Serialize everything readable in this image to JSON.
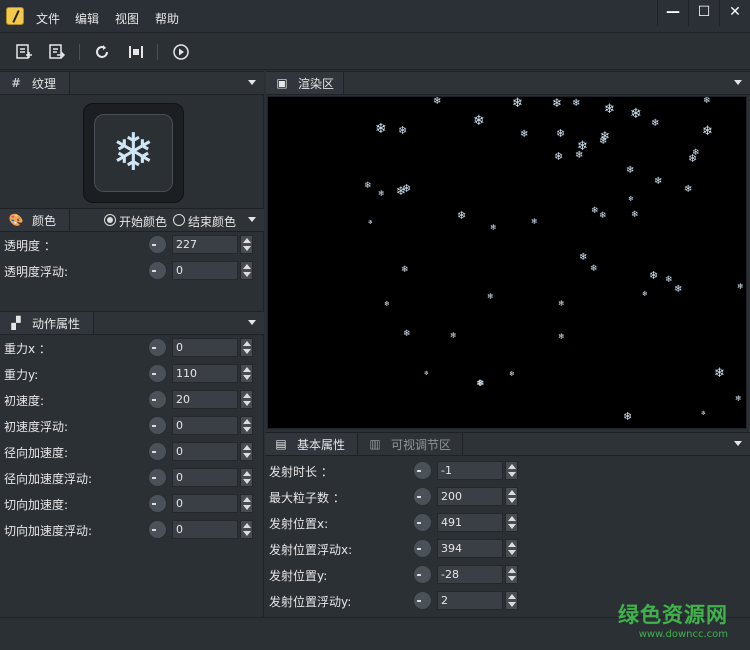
{
  "menu": [
    "文件",
    "编辑",
    "视图",
    "帮助"
  ],
  "window_buttons": [
    "—",
    "☐",
    "✕"
  ],
  "panels": {
    "texture": {
      "title": "纹理"
    },
    "color": {
      "title": "颜色",
      "start_color": "开始颜色",
      "end_color": "结束颜色",
      "rows": [
        {
          "label": "透明度 ：",
          "value": "227"
        },
        {
          "label": "透明度浮动:",
          "value": "0"
        }
      ]
    },
    "motion": {
      "title": "动作属性",
      "rows": [
        {
          "label": "重力x ：",
          "value": "0"
        },
        {
          "label": "重力y:",
          "value": "110"
        },
        {
          "label": "初速度:",
          "value": "20"
        },
        {
          "label": "初速度浮动:",
          "value": "0"
        },
        {
          "label": "径向加速度:",
          "value": "0"
        },
        {
          "label": "径向加速度浮动:",
          "value": "0"
        },
        {
          "label": "切向加速度:",
          "value": "0"
        },
        {
          "label": "切向加速度浮动:",
          "value": "0"
        }
      ]
    },
    "render": {
      "title": "渲染区"
    },
    "basic": {
      "tab_active": "基本属性",
      "tab_inactive": "可视调节区",
      "rows": [
        {
          "label": "发射时长 ：",
          "value": "-1"
        },
        {
          "label": "最大粒子数 ：",
          "value": "200"
        },
        {
          "label": "发射位置x:",
          "value": "491"
        },
        {
          "label": "发射位置浮动x:",
          "value": "394"
        },
        {
          "label": "发射位置y:",
          "value": "-28"
        },
        {
          "label": "发射位置浮动y:",
          "value": "2"
        }
      ]
    }
  },
  "watermark": {
    "line1": "绿色资源网",
    "line2": "www.downcc.com"
  }
}
